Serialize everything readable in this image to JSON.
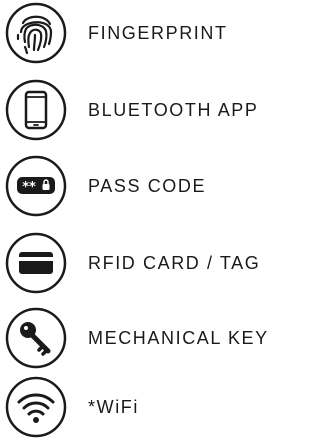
{
  "features": [
    {
      "label": "FINGERPRINT",
      "icon": "fingerprint-icon"
    },
    {
      "label": "BLUETOOTH APP",
      "icon": "smartphone-icon"
    },
    {
      "label": "PASS CODE",
      "icon": "passcode-icon",
      "icon_text": "**"
    },
    {
      "label": "RFID CARD / TAG",
      "icon": "card-icon"
    },
    {
      "label": "MECHANICAL KEY",
      "icon": "key-icon"
    },
    {
      "label": "*WiFi",
      "icon": "wifi-icon"
    }
  ],
  "colors": {
    "ink": "#1a1a1a",
    "background": "#ffffff"
  }
}
